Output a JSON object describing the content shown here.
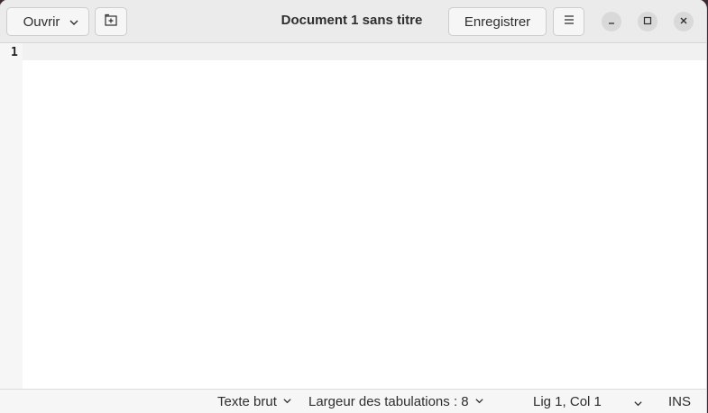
{
  "header": {
    "open_label": "Ouvrir",
    "title": "Document 1 sans titre",
    "save_label": "Enregistrer"
  },
  "icons": {
    "open_dropdown": "chevron-down-icon",
    "new_tab": "new-tab-icon",
    "menu": "hamburger-menu-icon",
    "minimize": "minimize-icon",
    "maximize": "maximize-icon",
    "close": "close-icon"
  },
  "editor": {
    "line_number": "1",
    "content": ""
  },
  "statusbar": {
    "language": "Texte brut",
    "tab_width": "Largeur des tabulations : 8",
    "cursor_position": "Lig 1, Col 1",
    "insert_mode": "INS"
  },
  "colors": {
    "headerbar_bg": "#ebebeb",
    "editor_bg": "#ffffff",
    "gutter_bg": "#f6f6f6",
    "window_control_bg": "#d9d9d9"
  }
}
